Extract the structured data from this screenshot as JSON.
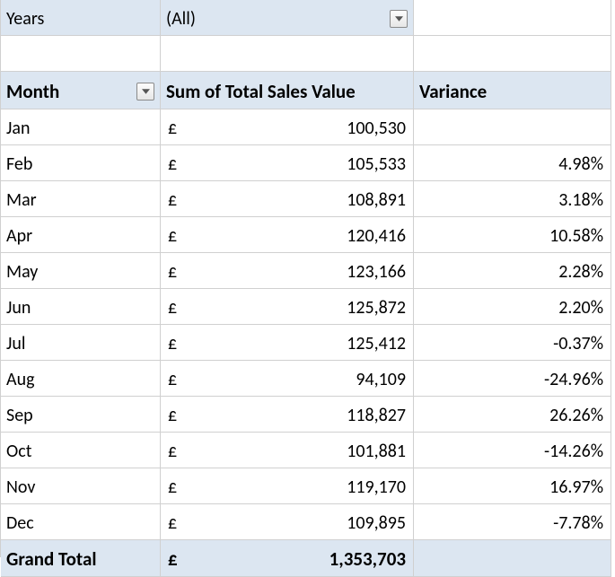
{
  "filter": {
    "label": "Years",
    "value": "(All)"
  },
  "headers": {
    "month": "Month",
    "sales": "Sum of Total Sales Value",
    "variance": "Variance"
  },
  "currency_symbol": "£",
  "rows": [
    {
      "month": "Jan",
      "sales": "100,530",
      "variance": ""
    },
    {
      "month": "Feb",
      "sales": "105,533",
      "variance": "4.98%"
    },
    {
      "month": "Mar",
      "sales": "108,891",
      "variance": "3.18%"
    },
    {
      "month": "Apr",
      "sales": "120,416",
      "variance": "10.58%"
    },
    {
      "month": "May",
      "sales": "123,166",
      "variance": "2.28%"
    },
    {
      "month": "Jun",
      "sales": "125,872",
      "variance": "2.20%"
    },
    {
      "month": "Jul",
      "sales": "125,412",
      "variance": "-0.37%"
    },
    {
      "month": "Aug",
      "sales": "94,109",
      "variance": "-24.96%"
    },
    {
      "month": "Sep",
      "sales": "118,827",
      "variance": "26.26%"
    },
    {
      "month": "Oct",
      "sales": "101,881",
      "variance": "-14.26%"
    },
    {
      "month": "Nov",
      "sales": "119,170",
      "variance": "16.97%"
    },
    {
      "month": "Dec",
      "sales": "109,895",
      "variance": "-7.78%"
    }
  ],
  "total": {
    "label": "Grand Total",
    "sales": "1,353,703",
    "variance": ""
  }
}
